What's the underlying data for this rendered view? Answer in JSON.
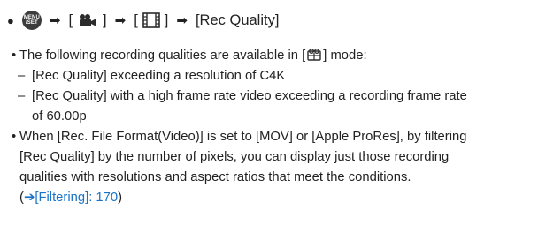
{
  "nav": {
    "menu_line1": "MENU",
    "menu_line2": "/SET",
    "arrow": "➡",
    "bracket_open": "[",
    "bracket_close": "]",
    "last_item": "[Rec Quality]",
    "video_icon": "video-mode-icon",
    "film_icon": "image-format-icon"
  },
  "content": {
    "p1_before": "The following recording qualities are available in [",
    "p1_after": "] mode:",
    "creative_icon": "creative-video-icon",
    "p1_sub1": "[Rec Quality] exceeding a resolution of C4K",
    "p1_sub2_line1": "[Rec Quality] with a high frame rate video exceeding a recording frame rate",
    "p1_sub2_line2": "of 60.00p",
    "p2_line1": "When [Rec. File Format(Video)] is set to [MOV] or [Apple ProRes], by filtering",
    "p2_line2": "[Rec Quality] by the number of pixels, you can display just those recording",
    "p2_line3": "qualities with resolutions and aspect ratios that meet the conditions.",
    "xref_open": "(",
    "xref_arrow": "➔",
    "xref_text": "[Filtering]: 170",
    "xref_close": ")"
  },
  "colors": {
    "text": "#222222",
    "link": "#1a73c7",
    "icon": "#3c3c3c"
  }
}
